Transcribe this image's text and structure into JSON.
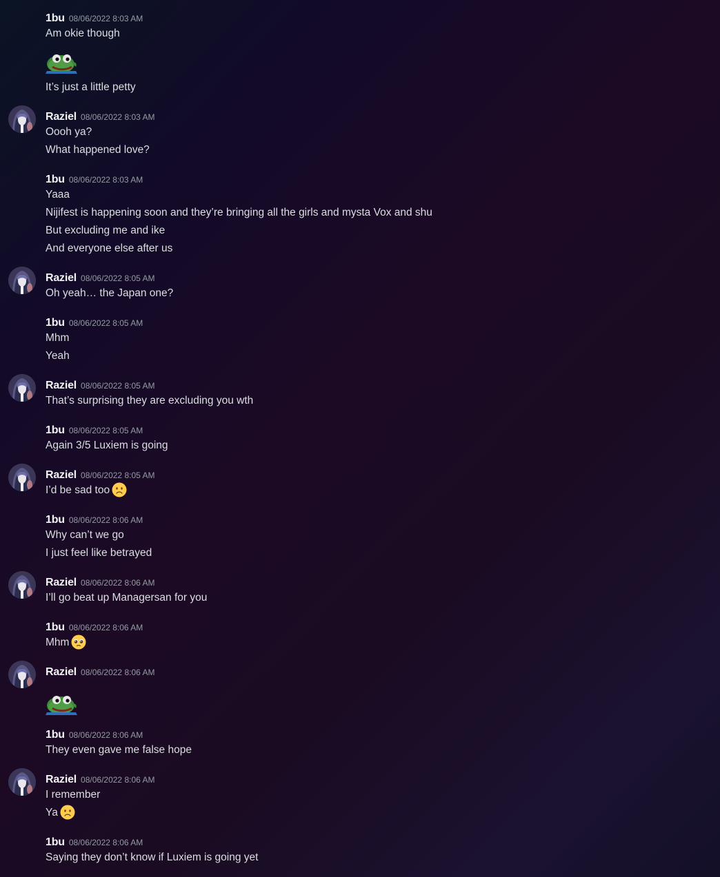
{
  "users": {
    "a": "1bu",
    "b": "Raziel"
  },
  "messages": [
    {
      "user": "1bu",
      "time": "08/06/2022 8:03 AM",
      "lines": [
        "Am okie though",
        "[pepe-sticker]",
        "It's just a little petty"
      ]
    },
    {
      "user": "Raziel",
      "time": "08/06/2022 8:03 AM",
      "lines": [
        "Oooh ya?",
        "What happened love?"
      ]
    },
    {
      "user": "1bu",
      "time": "08/06/2022 8:03 AM",
      "lines": [
        "Yaaa",
        "Nijifest is happening soon and they're bringing all the girls and mysta Vox and shu",
        "But excluding me and ike",
        "And everyone else after us"
      ]
    },
    {
      "user": "Raziel",
      "time": "08/06/2022 8:05 AM",
      "lines": [
        "Oh yeah… the Japan one?"
      ]
    },
    {
      "user": "1bu",
      "time": "08/06/2022 8:05 AM",
      "lines": [
        "Mhm",
        "Yeah"
      ]
    },
    {
      "user": "Raziel",
      "time": "08/06/2022 8:05 AM",
      "lines": [
        "That's surprising they are excluding you wth"
      ]
    },
    {
      "user": "1bu",
      "time": "08/06/2022 8:05 AM",
      "lines": [
        "Again 3/5 Luxiem is going"
      ]
    },
    {
      "user": "Raziel",
      "time": "08/06/2022 8:05 AM",
      "lines": [
        "I'd be sad too"
      ]
    },
    {
      "user": "1bu",
      "time": "08/06/2022 8:06 AM",
      "lines": [
        "Why can't we go",
        "I just feel like betrayed"
      ]
    },
    {
      "user": "Raziel",
      "time": "08/06/2022 8:06 AM",
      "lines": [
        "I'll go beat up Managersan for you"
      ]
    },
    {
      "user": "1bu",
      "time": "08/06/2022 8:06 AM",
      "lines": [
        "Mhm"
      ]
    },
    {
      "user": "Raziel",
      "time": "08/06/2022 8:06 AM",
      "lines": [
        "[pepe-sticker]"
      ]
    },
    {
      "user": "1bu",
      "time": "08/06/2022 8:06 AM",
      "lines": [
        "They even gave me false hope"
      ]
    },
    {
      "user": "Raziel",
      "time": "08/06/2022 8:06 AM",
      "lines": [
        "I remember",
        "Ya"
      ]
    },
    {
      "user": "1bu",
      "time": "08/06/2022 8:06 AM",
      "lines": [
        "Saying they don't know if Luxiem is going yet"
      ]
    }
  ],
  "text": {
    "m1_u": "1bu",
    "m1_t": "08/06/2022 8:03 AM",
    "m1_l1": "Am okie though",
    "m1_l3": "It’s just a little petty",
    "m2_u": "Raziel",
    "m2_t": "08/06/2022 8:03 AM",
    "m2_l1": "Oooh ya?",
    "m2_l2": "What happened love?",
    "m3_u": "1bu",
    "m3_t": "08/06/2022 8:03 AM",
    "m3_l1": "Yaaa",
    "m3_l2": "Nijifest is happening soon and they’re bringing all the girls and mysta Vox and shu",
    "m3_l3": "But excluding me and ike",
    "m3_l4": "And everyone else after us",
    "m4_u": "Raziel",
    "m4_t": "08/06/2022 8:05 AM",
    "m4_l1": "Oh yeah… the Japan one?",
    "m5_u": "1bu",
    "m5_t": "08/06/2022 8:05 AM",
    "m5_l1": "Mhm",
    "m5_l2": "Yeah",
    "m6_u": "Raziel",
    "m6_t": "08/06/2022 8:05 AM",
    "m6_l1": "That’s surprising they are excluding you wth",
    "m7_u": "1bu",
    "m7_t": "08/06/2022 8:05 AM",
    "m7_l1": "Again 3/5 Luxiem is going",
    "m8_u": "Raziel",
    "m8_t": "08/06/2022 8:05 AM",
    "m8_l1": "I’d be sad too",
    "m9_u": "1bu",
    "m9_t": "08/06/2022 8:06 AM",
    "m9_l1": "Why can’t we go",
    "m9_l2": "I just feel like betrayed",
    "m10_u": "Raziel",
    "m10_t": "08/06/2022 8:06 AM",
    "m10_l1": "I’ll go beat up Managersan for you",
    "m11_u": "1bu",
    "m11_t": "08/06/2022 8:06 AM",
    "m11_l1": "Mhm",
    "m12_u": "Raziel",
    "m12_t": "08/06/2022 8:06 AM",
    "m13_u": "1bu",
    "m13_t": "08/06/2022 8:06 AM",
    "m13_l1": "They even gave me false hope",
    "m14_u": "Raziel",
    "m14_t": "08/06/2022 8:06 AM",
    "m14_l1": "I remember",
    "m14_l2": "Ya",
    "m15_u": "1bu",
    "m15_t": "08/06/2022 8:06 AM",
    "m15_l1": "Saying they don’t know if Luxiem is going yet"
  },
  "icons": {
    "sad_emoji": "slightly-frowning-face-icon",
    "pleading_emoji": "pleading-face-icon",
    "sticker": "pepe-frog-sticker"
  },
  "colors": {
    "username": "#f2f3f5",
    "timestamp": "#949ba4",
    "message": "#dbdee1"
  }
}
